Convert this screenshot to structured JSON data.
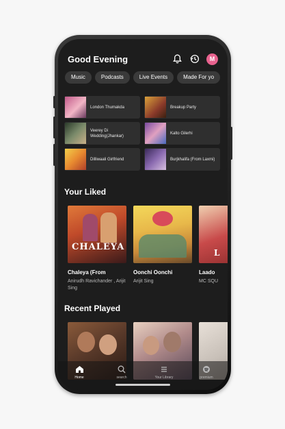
{
  "header": {
    "greeting": "Good Evening",
    "avatar_initial": "M"
  },
  "chips": [
    "Music",
    "Podcasts",
    "Live Events",
    "Made For yo"
  ],
  "quick_picks": [
    {
      "label": "London Thumakda"
    },
    {
      "label": "Breakup Party"
    },
    {
      "label": "Veerey Di Wedding(Jhankar)"
    },
    {
      "label": "Kalto Gilerhi"
    },
    {
      "label": "Dilliwaali Girlfriend"
    },
    {
      "label": "Burjkhalifa (From Laxmi)"
    }
  ],
  "liked": {
    "title": "Your Liked",
    "items": [
      {
        "title": "Chaleya (From",
        "subtitle": "Anirudh Ravichander , Arijit Sing",
        "cover_text": "CHALEYA"
      },
      {
        "title": "Oonchi Oonchi",
        "subtitle": "Arijit Sing",
        "cover_text": ""
      },
      {
        "title": "Laado",
        "subtitle": "MC SQU",
        "cover_text": "L"
      }
    ]
  },
  "recent": {
    "title": "Recent Played"
  },
  "nav": [
    {
      "label": "Home",
      "icon": "home-icon"
    },
    {
      "label": "search",
      "icon": "search-icon"
    },
    {
      "label": "Your Library",
      "icon": "library-icon"
    },
    {
      "label": "premium",
      "icon": "premium-icon"
    }
  ],
  "colors": {
    "background": "#1d1d1d",
    "chip": "#3a3a3a",
    "card": "#2f2f2f",
    "avatar": "#e8628e"
  }
}
